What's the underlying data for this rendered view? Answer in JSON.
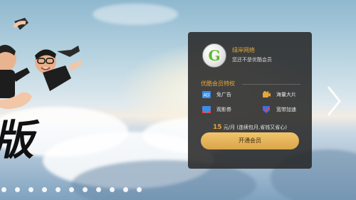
{
  "vip_card": {
    "user_name": "绿岸网络",
    "user_status": "您还不是优酷会员",
    "logo_letter": "G",
    "section_title": "优酷会员特权",
    "perks": [
      {
        "label": "免广告",
        "icon": "ad-icon"
      },
      {
        "label": "海量大片",
        "icon": "film-icon"
      },
      {
        "label": "观影券",
        "icon": "ticket-icon"
      },
      {
        "label": "宽带加速",
        "icon": "speed-icon"
      }
    ],
    "price_value": "15",
    "price_suffix": " 元/月 (连续包月,省钱又省心)",
    "open_button": "开通会员"
  },
  "banner": {
    "headline_char": "版",
    "slide_count": 12
  },
  "colors": {
    "accent": "#e5a73a",
    "card_bg": "#282828",
    "button": "#e0ad52"
  }
}
